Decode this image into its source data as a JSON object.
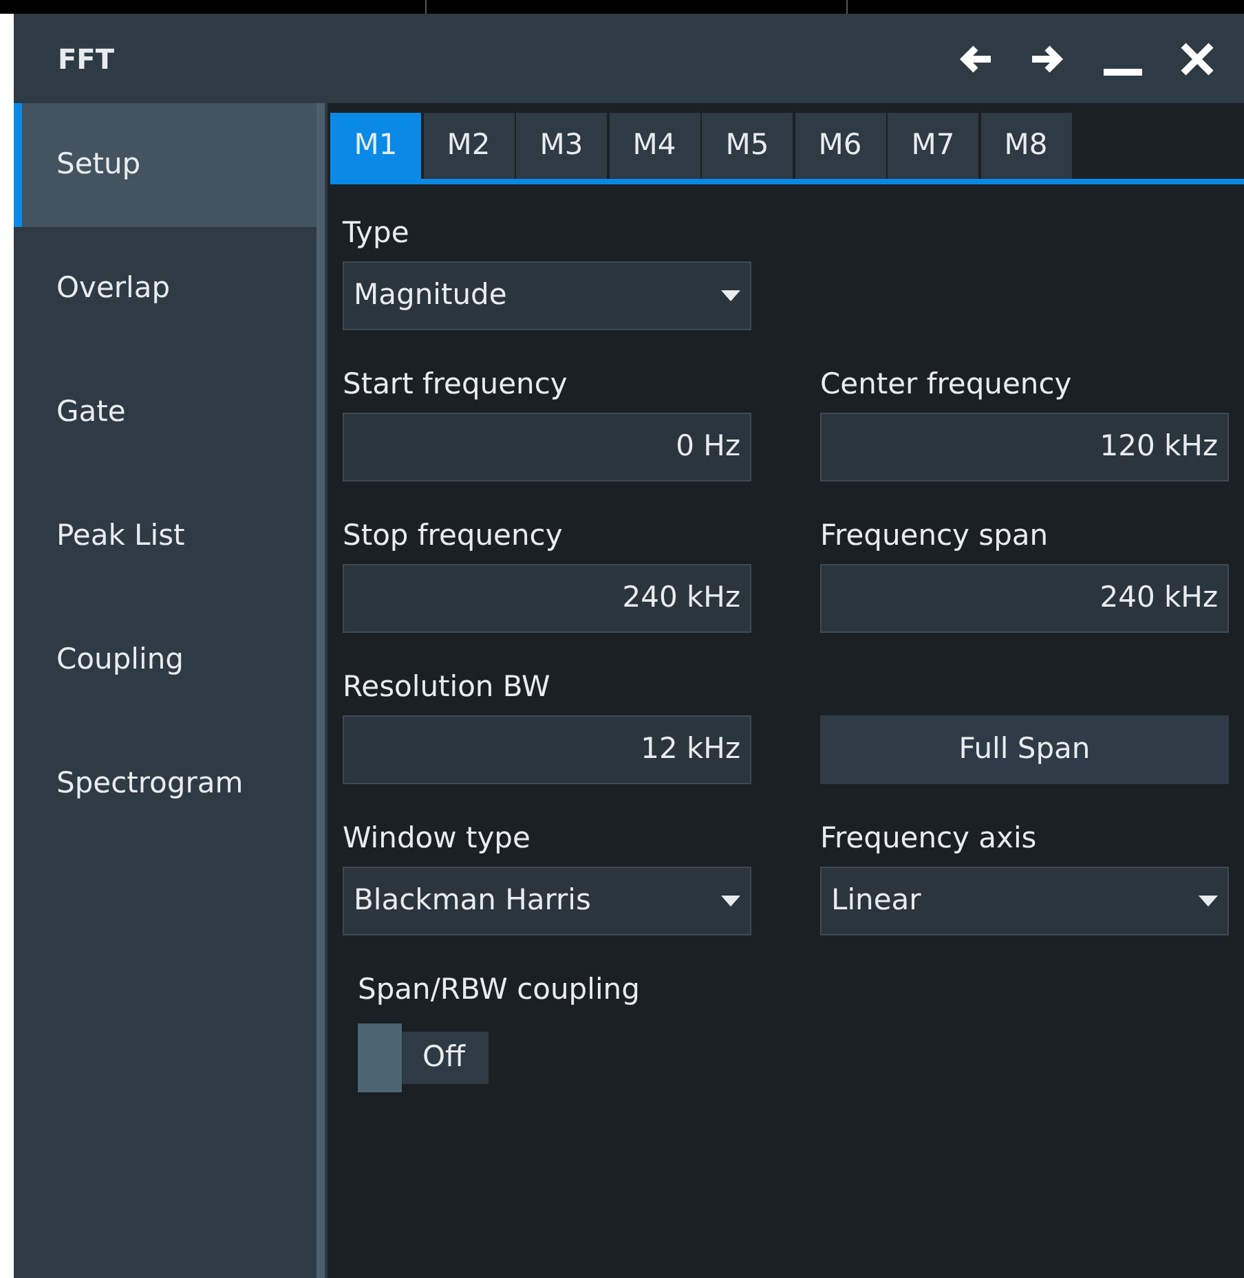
{
  "window": {
    "title": "FFT"
  },
  "sidebar": {
    "items": [
      {
        "label": "Setup",
        "selected": true
      },
      {
        "label": "Overlap",
        "selected": false
      },
      {
        "label": "Gate",
        "selected": false
      },
      {
        "label": "Peak List",
        "selected": false
      },
      {
        "label": "Coupling",
        "selected": false
      },
      {
        "label": "Spectrogram",
        "selected": false
      }
    ]
  },
  "tabs": [
    {
      "label": "M1",
      "selected": true
    },
    {
      "label": "M2",
      "selected": false
    },
    {
      "label": "M3",
      "selected": false
    },
    {
      "label": "M4",
      "selected": false
    },
    {
      "label": "M5",
      "selected": false
    },
    {
      "label": "M6",
      "selected": false
    },
    {
      "label": "M7",
      "selected": false
    },
    {
      "label": "M8",
      "selected": false
    }
  ],
  "rows": [
    [
      {
        "kind": "dropdown",
        "label": "Type",
        "value": "Magnitude"
      }
    ],
    [
      {
        "kind": "number",
        "label": "Start frequency",
        "value": "0 Hz"
      },
      {
        "kind": "number",
        "label": "Center frequency",
        "value": "120 kHz"
      }
    ],
    [
      {
        "kind": "number",
        "label": "Stop frequency",
        "value": "240 kHz"
      },
      {
        "kind": "number",
        "label": "Frequency span",
        "value": "240 kHz"
      }
    ],
    [
      {
        "kind": "number",
        "label": "Resolution BW",
        "value": "12 kHz"
      },
      {
        "kind": "button",
        "value": "Full Span"
      }
    ],
    [
      {
        "kind": "dropdown",
        "label": "Window type",
        "value": "Blackman Harris"
      },
      {
        "kind": "dropdown",
        "label": "Frequency axis",
        "value": "Linear"
      }
    ]
  ],
  "coupling": {
    "label": "Span/RBW coupling",
    "on": false,
    "value": "Off"
  }
}
